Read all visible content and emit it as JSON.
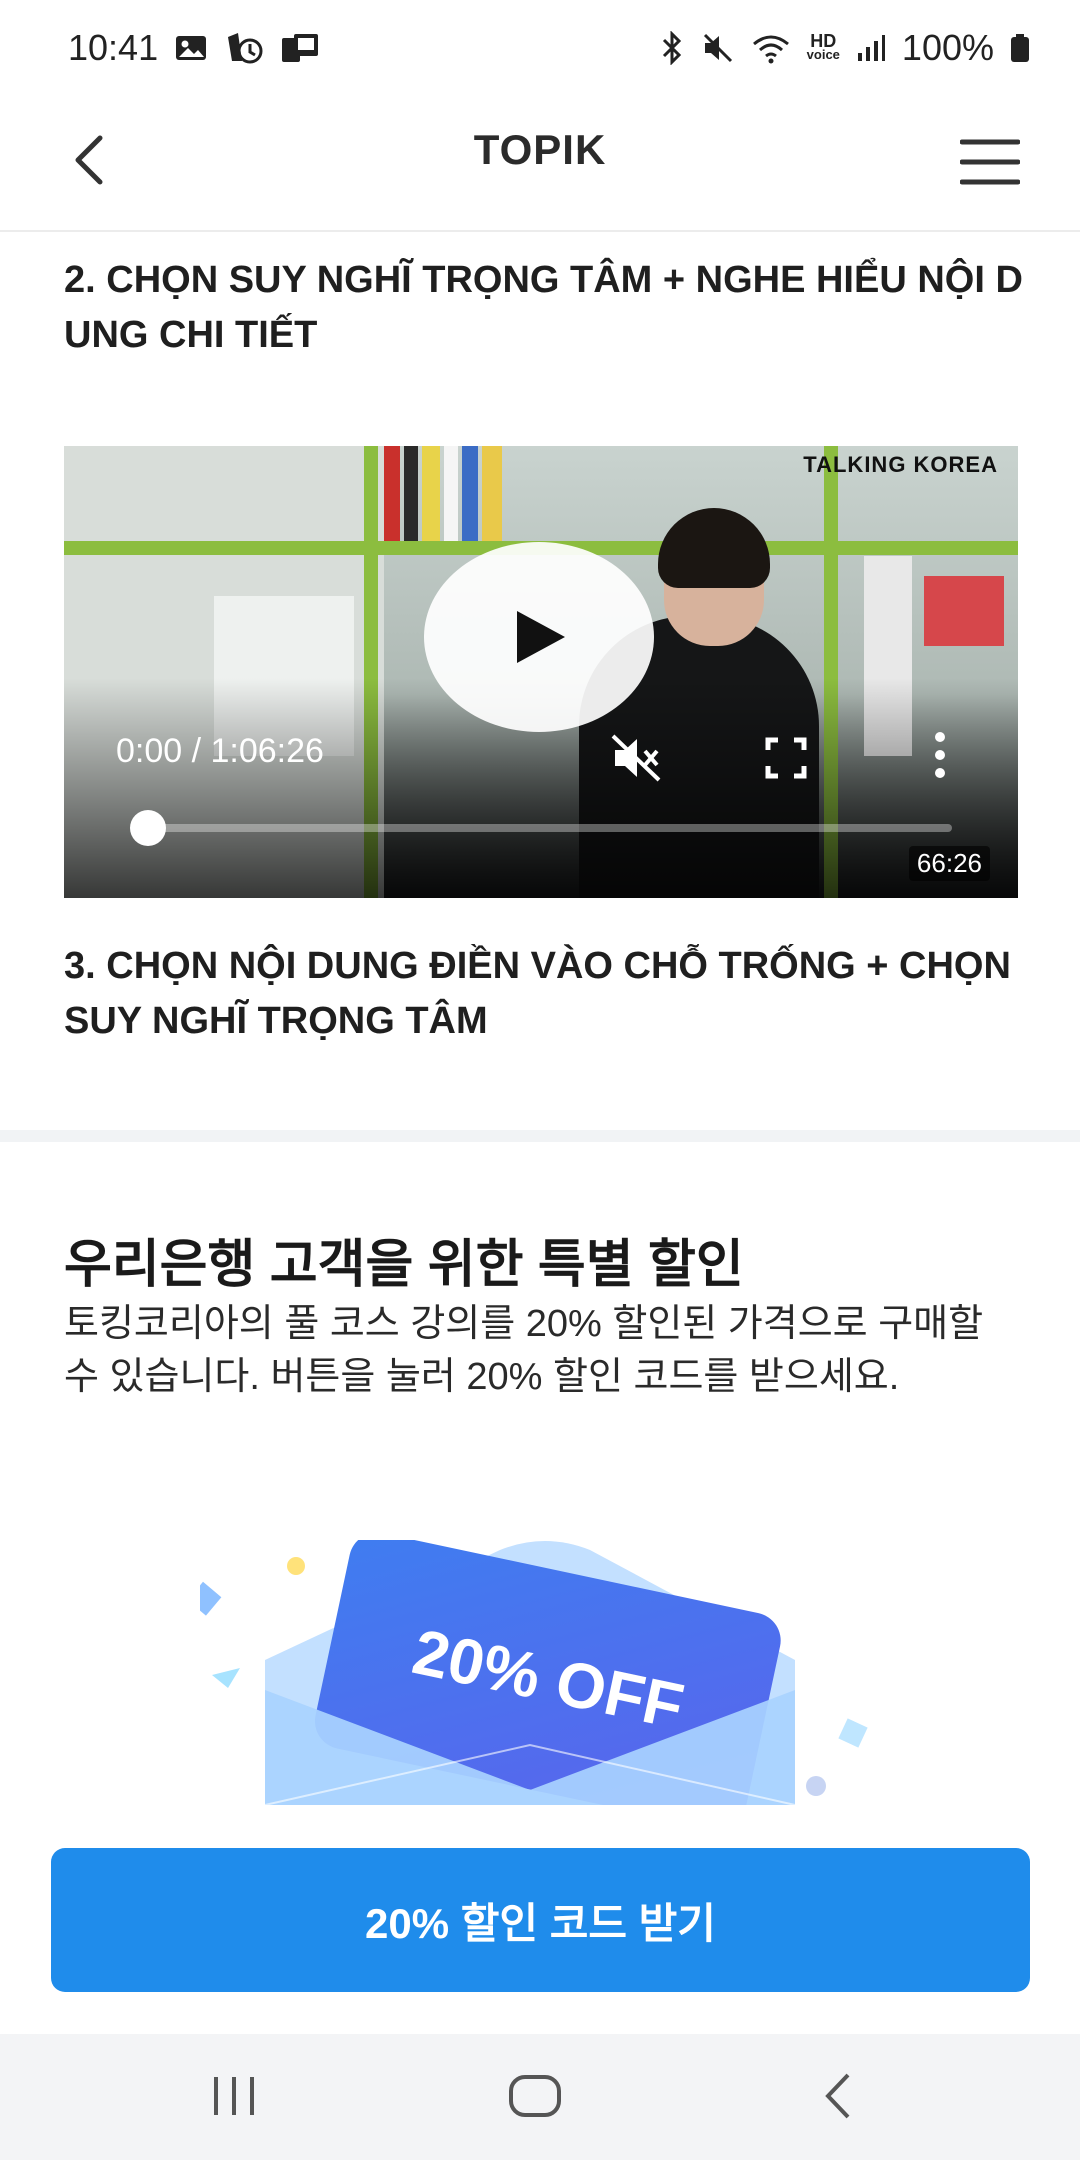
{
  "status_bar": {
    "time": "10:41",
    "battery": "100%",
    "hd_voice_line1": "HD",
    "hd_voice_line2": "voice",
    "icons_left": [
      "image-icon",
      "alarm-icon",
      "app-notification-icon"
    ],
    "icons_right": [
      "bluetooth-icon",
      "mute-icon",
      "wifi-icon",
      "hd-voice-icon",
      "signal-icon",
      "battery-icon"
    ]
  },
  "app_bar": {
    "title": "TOPIK",
    "back_icon": "chevron-left-icon",
    "menu_icon": "hamburger-menu-icon"
  },
  "lessons": {
    "lesson2_title": "2. CHỌN SUY NGHĨ TRỌNG TÂM + NGHE HIỂU NỘI DUNG CHI TIẾT",
    "lesson3_title": "3. CHỌN NỘI DUNG ĐIỀN VÀO CHỖ TRỐNG + CHỌN SUY NGHĨ TRỌNG TÂM"
  },
  "video": {
    "watermark": "TALKING KOREA",
    "time_display": "0:00 / 1:06:26",
    "duration_badge": "66:26",
    "progress": 0.02,
    "muted": true
  },
  "promo": {
    "title": "우리은행 고객을 위한 특별 할인",
    "description": "토킹코리아의 풀 코스 강의를 20% 할인된 가격으로 구매할 수 있습니다. 버튼을 눌러 20% 할인 코드를 받으세요.",
    "coupon_text": "20% OFF",
    "cta_label": "20% 할인 코드 받기"
  },
  "colors": {
    "accent": "#1f8ceb",
    "coupon_start": "#3f7df0",
    "coupon_end": "#5b63ec",
    "envelope": "#a9d3ff"
  },
  "nav_bar": {
    "icons": [
      "recent-apps-icon",
      "home-icon",
      "back-icon"
    ]
  }
}
